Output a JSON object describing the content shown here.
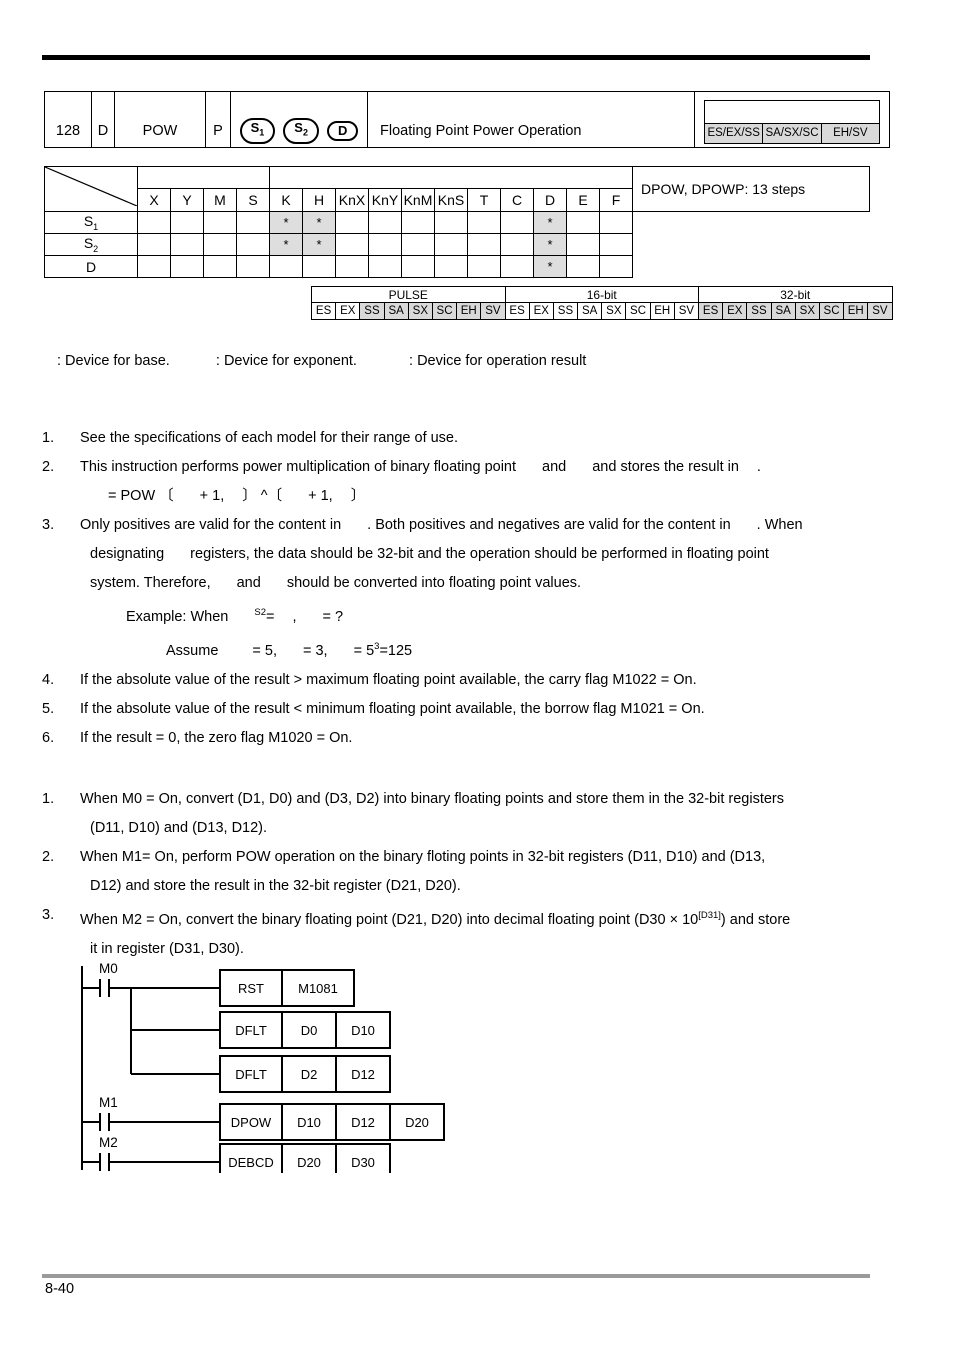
{
  "header": {
    "number": "128",
    "d_flag": "D",
    "mnemonic": "POW",
    "p_flag": "P",
    "operands": [
      "S1",
      "S2",
      "D"
    ],
    "description": "Floating Point Power Operation",
    "models": [
      "ES/EX/SS",
      "SA/SX/SC",
      "EH/SV"
    ]
  },
  "matrix": {
    "columns": [
      "X",
      "Y",
      "M",
      "S",
      "K",
      "H",
      "KnX",
      "KnY",
      "KnM",
      "KnS",
      "T",
      "C",
      "D",
      "E",
      "F"
    ],
    "rows": [
      {
        "label": "S",
        "sub": "1",
        "marks": [
          "",
          "",
          "",
          "",
          "*",
          "*",
          "",
          "",
          "",
          "",
          "",
          "",
          "*",
          "",
          ""
        ]
      },
      {
        "label": "S",
        "sub": "2",
        "marks": [
          "",
          "",
          "",
          "",
          "*",
          "*",
          "",
          "",
          "",
          "",
          "",
          "",
          "*",
          "",
          ""
        ]
      },
      {
        "label": "D",
        "sub": "",
        "marks": [
          "",
          "",
          "",
          "",
          "",
          "",
          "",
          "",
          "",
          "",
          "",
          "",
          "*",
          "",
          ""
        ]
      }
    ],
    "steps": "DPOW, DPOWP: 13 steps"
  },
  "pulse_table": {
    "groups": [
      "PULSE",
      "16-bit",
      "32-bit"
    ],
    "models": [
      "ES",
      "EX",
      "SS",
      "SA",
      "SX",
      "SC",
      "EH",
      "SV"
    ],
    "pulse_shaded": [
      false,
      false,
      true,
      true,
      true,
      true,
      true,
      true
    ],
    "bit16_shaded": [
      false,
      false,
      false,
      false,
      false,
      false,
      false,
      false
    ],
    "bit32_shaded": [
      true,
      true,
      true,
      true,
      true,
      true,
      true,
      true
    ]
  },
  "legend": {
    "base": ": Device for base.",
    "exponent": ": Device for exponent.",
    "result": ": Device for operation result"
  },
  "explanations": {
    "items": [
      {
        "num": "1.",
        "text": "See the specifications of each model for their range of use."
      },
      {
        "num": "2.",
        "text": "This instruction performs power multiplication of binary floating point"
      },
      {
        "num": "3.",
        "text": "Only positives are valid for the content in"
      },
      {
        "num": "4.",
        "text": "If the absolute value of the result"
      },
      {
        "num": "5.",
        "text": "If the absolute value of the result"
      },
      {
        "num": "6.",
        "text": "If the result = 0, the zero flag M1020 = On."
      }
    ],
    "item2_mid": "and",
    "item2_tail": "and stores the result in",
    "item2_period": ".",
    "formula": "= POW",
    "formula_open1": "〔",
    "formula_plus1": "+ 1,",
    "formula_close1": "〕",
    "formula_caret": "^",
    "formula_open2": "〔",
    "formula_plus2": "+ 1,",
    "formula_close2": "〕",
    "item3_mid": ". Both positives and negatives are valid for the content in",
    "item3_tail": ". When",
    "item3_line2_a": "designating",
    "item3_line2_b": "registers, the data should be 32-bit and the operation should be performed in floating point",
    "item3_line3_a": "system. Therefore,",
    "item3_line3_b": "and",
    "item3_line3_c": "should be converted into floating point values.",
    "example_label": "Example: When",
    "example_sup": "S2",
    "example_eq": "=",
    "example_comma": ",",
    "example_q": "= ?",
    "assume_label": "Assume",
    "assume_a": "= 5,",
    "assume_b": "= 3,",
    "assume_c": "= 5",
    "assume_sup": "3",
    "assume_d": "=125",
    "item4_gt": ">",
    "item4_tail": "maximum floating point available, the carry flag M1022 = On.",
    "item5_lt": "<",
    "item5_tail": "minimum floating point available, the borrow flag M1021 = On."
  },
  "program_example": {
    "items": [
      {
        "num": "1.",
        "line1": "When M0 = On, convert (D1, D0) and (D3, D2) into binary floating points and store them in the 32-bit registers",
        "line2": "(D11, D10) and (D13, D12)."
      },
      {
        "num": "2.",
        "line1": "When M1= On, perform POW operation on the binary floting points in 32-bit registers (D11, D10) and (D13,",
        "line2": "D12) and store the result in the 32-bit register (D21, D20)."
      },
      {
        "num": "3.",
        "line1a": "When M2 = On, convert the binary floating point (D21, D20) into decimal floating point (D30 × 10",
        "line1sup": "[D31]",
        "line1b": ") and store",
        "line2": "it in register (D31, D30)."
      }
    ]
  },
  "ladder": {
    "contacts": [
      {
        "label": "M0"
      },
      {
        "label": "M1"
      },
      {
        "label": "M2"
      }
    ],
    "rungs": [
      {
        "cells": [
          "RST",
          "M1081"
        ]
      },
      {
        "cells": [
          "DFLT",
          "D0",
          "D10"
        ]
      },
      {
        "cells": [
          "DFLT",
          "D2",
          "D12"
        ]
      },
      {
        "cells": [
          "DPOW",
          "D10",
          "D12",
          "D20"
        ]
      },
      {
        "cells": [
          "DEBCD",
          "D20",
          "D30"
        ]
      }
    ]
  },
  "footer": {
    "page": "8-40"
  }
}
